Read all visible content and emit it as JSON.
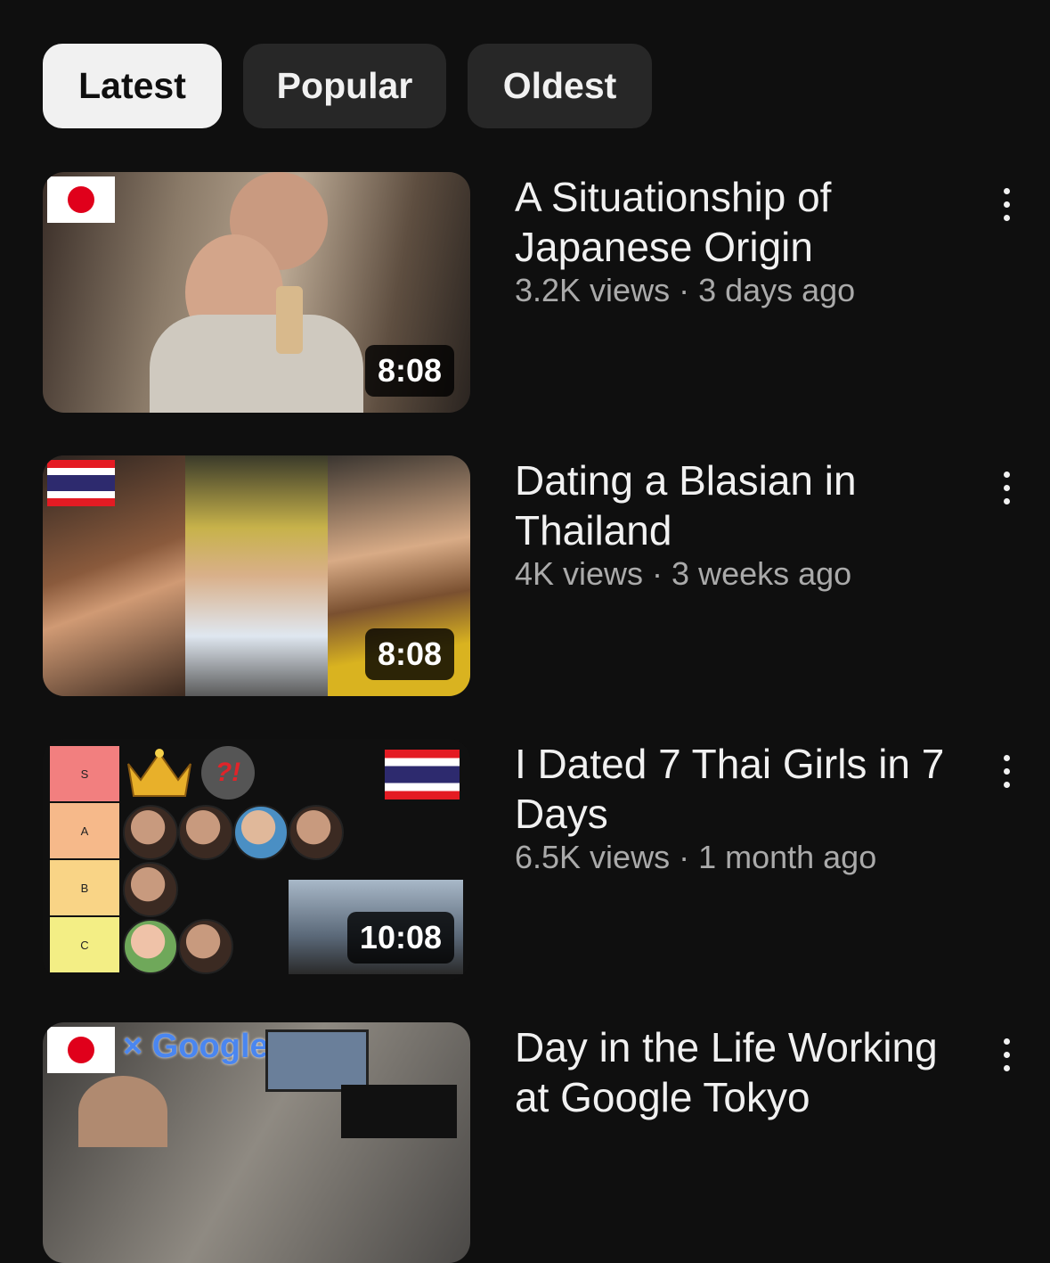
{
  "filters": {
    "chips": [
      {
        "label": "Latest",
        "active": true
      },
      {
        "label": "Popular",
        "active": false
      },
      {
        "label": "Oldest",
        "active": false
      }
    ]
  },
  "videos": [
    {
      "title": "A Situationship of Japanese Origin",
      "meta": "3.2K views · 3 days ago",
      "duration": "8:08",
      "flag": "japan-flag"
    },
    {
      "title": "Dating a Blasian in Thailand",
      "meta": "4K views · 3 weeks ago",
      "duration": "8:08",
      "flag": "thailand-flag"
    },
    {
      "title": "I Dated 7 Thai Girls in 7 Days",
      "meta": "6.5K views · 1 month ago",
      "duration": "10:08",
      "flag": "thailand-flag",
      "tiers": [
        "S",
        "A",
        "B",
        "C"
      ],
      "overlay_text": "?!"
    },
    {
      "title": "Day in the Life Working at Google Tokyo",
      "meta": "",
      "duration": "",
      "flag": "japan-flag",
      "overlay_text": "× Google"
    }
  ],
  "colors": {
    "background": "#0f0f0f",
    "chip": "#272727",
    "chip_active": "#f1f1f1",
    "meta_text": "#aaaaaa"
  }
}
